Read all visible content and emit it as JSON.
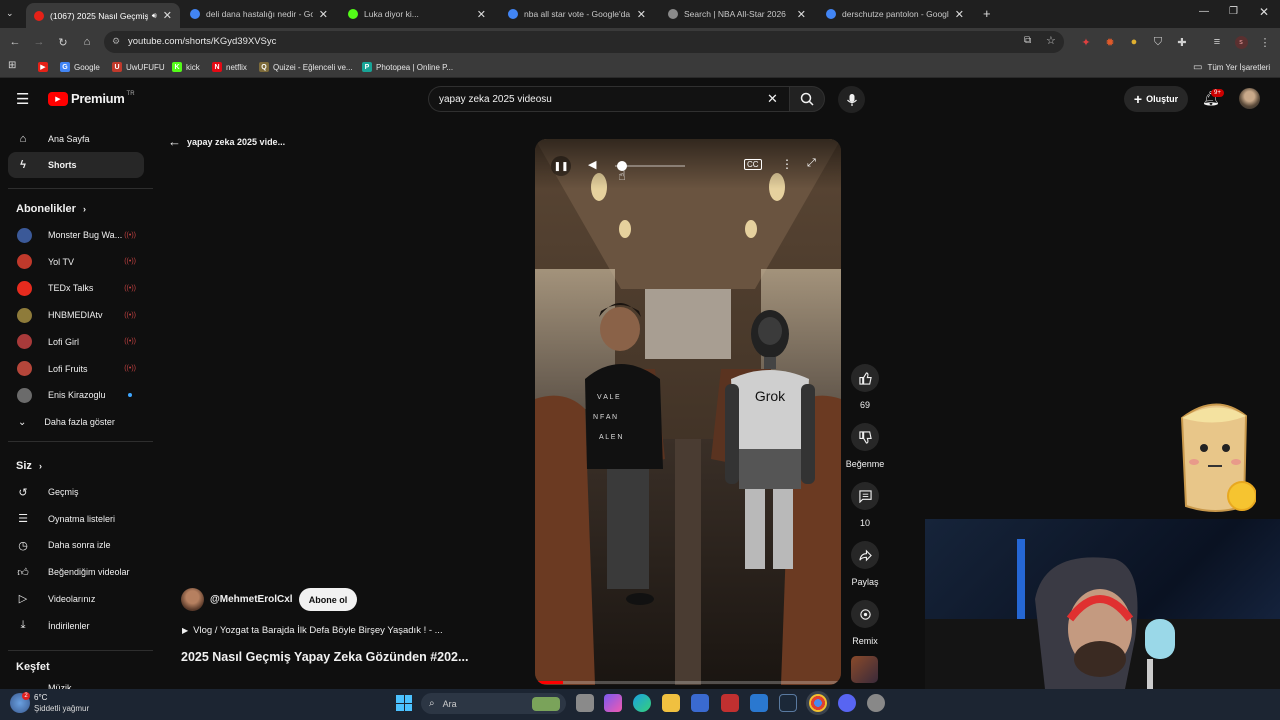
{
  "browser": {
    "tabs": [
      {
        "title": "(1067) 2025 Nasıl Geçmiş Ya...",
        "active": true,
        "fav": "#e62117"
      },
      {
        "title": "deli dana hastalığı nedir - Goog...",
        "active": false,
        "fav": "#4285f4"
      },
      {
        "title": "Luka diyor ki...",
        "active": false,
        "fav": "#53fc18"
      },
      {
        "title": "nba all star vote - Google'da Ar...",
        "active": false,
        "fav": "#4285f4"
      },
      {
        "title": "Search | NBA All-Star 2026",
        "active": false,
        "fav": "#8a8a8a"
      },
      {
        "title": "derschutze pantolon - Google'...",
        "active": false,
        "fav": "#4285f4"
      }
    ],
    "url": "youtube.com/shorts/KGyd39XVSyc",
    "bookmarks": [
      {
        "label": "",
        "color": "#e62117",
        "glyph": "▶"
      },
      {
        "label": "Google",
        "color": "#4285f4",
        "glyph": "G"
      },
      {
        "label": "UwUFUFU",
        "color": "#c0392b",
        "glyph": "U"
      },
      {
        "label": "kick",
        "color": "#53fc18",
        "glyph": "K"
      },
      {
        "label": "netflix",
        "color": "#e50914",
        "glyph": "N"
      },
      {
        "label": "Quizei - Eğlenceli ve...",
        "color": "#7d6b3a",
        "glyph": "Q"
      },
      {
        "label": "Photopea | Online P...",
        "color": "#18a497",
        "glyph": "P"
      }
    ],
    "all_bookmarks": "Tüm Yer İşaretleri"
  },
  "youtube": {
    "logo": "Premium",
    "logo_region": "TR",
    "search_value": "yapay zeka 2025 videosu",
    "create_label": "Oluştur",
    "notif_badge": "9+",
    "sidebar": {
      "main": [
        {
          "label": "Ana Sayfa",
          "icon": "home-icon",
          "selected": false
        },
        {
          "label": "Shorts",
          "icon": "shorts-icon",
          "selected": true
        }
      ],
      "subs_title": "Abonelikler",
      "subs": [
        {
          "name": "Monster Bug Wa...",
          "color": "#3b5998",
          "live": true
        },
        {
          "name": "Yol TV",
          "color": "#c0392b",
          "live": true
        },
        {
          "name": "TEDx Talks",
          "color": "#e62b1e",
          "live": true
        },
        {
          "name": "HNBMEDIAtv",
          "color": "#8e7b3a",
          "live": true
        },
        {
          "name": "Lofi Girl",
          "color": "#a83a3a",
          "live": true
        },
        {
          "name": "Lofi Fruits",
          "color": "#b5463a",
          "live": true
        },
        {
          "name": "Enis Kirazoglu",
          "color": "#6b6b6b",
          "live": false
        }
      ],
      "show_more": "Daha fazla göster",
      "you_title": "Siz",
      "you": [
        {
          "label": "Geçmiş",
          "icon": "history-icon"
        },
        {
          "label": "Oynatma listeleri",
          "icon": "playlist-icon"
        },
        {
          "label": "Daha sonra izle",
          "icon": "clock-icon"
        },
        {
          "label": "Beğendiğim videolar",
          "icon": "like-icon"
        },
        {
          "label": "Videolarınız",
          "icon": "video-icon"
        },
        {
          "label": "İndirilenler",
          "icon": "download-icon"
        }
      ],
      "explore_title": "Keşfet",
      "explore_partial": "Müzik"
    },
    "back_label": "yapay zeka 2025 vide...",
    "short": {
      "channel": "@MehmetErolCxl",
      "subscribe": "Abone ol",
      "related": "Vlog / Yozgat ta Barajda İlk Defa Böyle Birşey Yaşadık ! - ...",
      "title": "2025 Nasıl Geçmiş Yapay Zeka Gözünden #202...",
      "robot_label": "Grok",
      "likes": "69",
      "dislike_label": "Beğenme",
      "comments": "10",
      "share_label": "Paylaş",
      "remix_label": "Remix"
    }
  },
  "taskbar": {
    "temp": "6°C",
    "weather": "Şiddetli yağmur",
    "weather_badge": "2",
    "search_placeholder": "Ara"
  }
}
